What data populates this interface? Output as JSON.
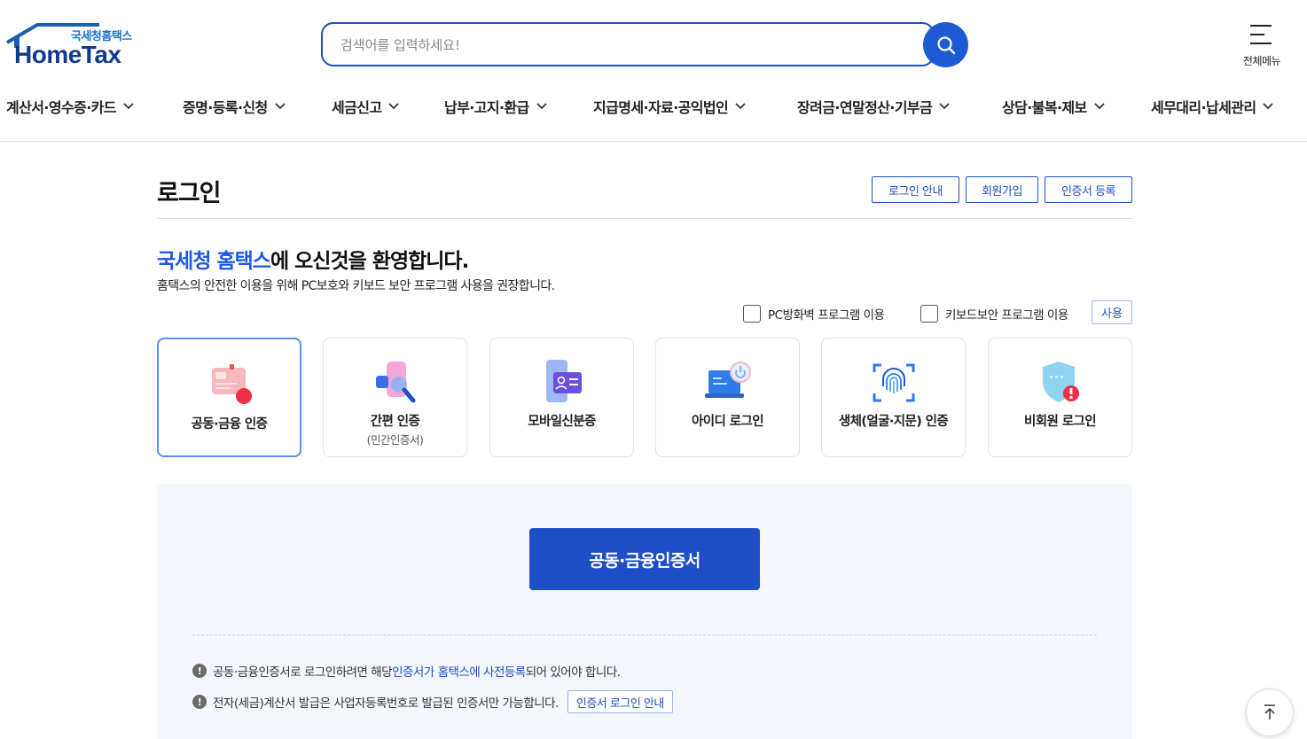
{
  "header": {
    "logo_ko": "국세청홈택스",
    "logo_en": "HomeTax",
    "search_placeholder": "검색어를 입력하세요!",
    "allmenu_label": "전체메뉴"
  },
  "nav": {
    "items": [
      {
        "label": "계산서·영수증·카드"
      },
      {
        "label": "증명·등록·신청"
      },
      {
        "label": "세금신고"
      },
      {
        "label": "납부·고지·환급"
      },
      {
        "label": "지급명세·자료·공익법인"
      },
      {
        "label": "장려금·연말정산·기부금"
      },
      {
        "label": "상담·불복·제보"
      },
      {
        "label": "세무대리·납세관리"
      }
    ]
  },
  "page": {
    "title": "로그인",
    "buttons": {
      "login_guide": "로그인 안내",
      "signup": "회원가입",
      "cert_register": "인증서 등록"
    },
    "welcome_highlight": "국세청 홈택스",
    "welcome_rest": "에 오신것을 환영합니다.",
    "subtitle": "홈택스의 안전한 이용을 위해 PC보호와 키보드 보안 프로그램 사용을 권장합니다.",
    "options": {
      "firewall": "PC방화벽 프로그램 이용",
      "keyboard": "키보드보안 프로그램 이용",
      "use_button": "사용"
    }
  },
  "methods": [
    {
      "label": "공동·금융 인증",
      "sub": "",
      "icon": "certificate-icon",
      "active": true
    },
    {
      "label": "간편 인증",
      "sub": "(민간인증서)",
      "icon": "simple-auth-icon",
      "active": false
    },
    {
      "label": "모바일신분증",
      "sub": "",
      "icon": "mobile-id-icon",
      "active": false
    },
    {
      "label": "아이디 로그인",
      "sub": "",
      "icon": "laptop-icon",
      "active": false
    },
    {
      "label": "생체(얼굴·지문) 인증",
      "sub": "",
      "icon": "fingerprint-icon",
      "active": false
    },
    {
      "label": "비회원 로그인",
      "sub": "",
      "icon": "shield-icon",
      "active": false
    }
  ],
  "panel": {
    "main_button": "공동·금융인증서",
    "note1_a": "공동·금융인증서로 로그인하려면 해당 ",
    "note1_link": "인증서가 홈택스에 사전등록",
    "note1_b": "되어 있어야 합니다.",
    "note2": "전자(세금)계산서 발급은 사업자등록번호로 발급된 인증서만 가능합니다.",
    "note2_button": "인증서 로그인 안내"
  },
  "colors": {
    "primary": "#1f4fc7",
    "accent": "#1d5ae0",
    "logo_navy": "#113a8c"
  }
}
